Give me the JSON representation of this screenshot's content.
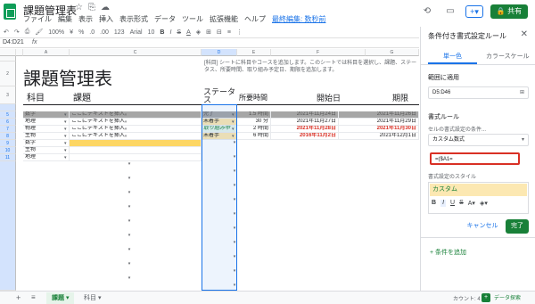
{
  "doc": {
    "title": "課題管理表"
  },
  "menu": [
    "ファイル",
    "編集",
    "表示",
    "挿入",
    "表示形式",
    "データ",
    "ツール",
    "拡張機能",
    "ヘルプ"
  ],
  "last_edit": "最終編集: 数秒前",
  "share_label": "共有",
  "toolbar": {
    "zoom": "100%",
    "currency": "¥",
    "percent": "%",
    "dec1": ".0",
    "dec2": ".00",
    "format": "123",
    "font": "Arial",
    "size": "10",
    "bold": "B",
    "italic": "I",
    "strike": "S",
    "color": "A"
  },
  "formula": {
    "namebox": "D4:D21",
    "fx": "fx"
  },
  "grid": {
    "columns": [
      "A",
      "B",
      "C",
      "D",
      "E",
      "F",
      "G"
    ],
    "title": "課題管理表",
    "description": "[科目] シートに科目やコースを追加します。このシートでは科目を選択し、課題、ステータス、所要時間、取り組み予定日、期限を追加します。",
    "headers": {
      "subject": "科目",
      "task": "課題",
      "status": "ステータス",
      "time": "所要時間",
      "start": "開始日",
      "due": "期限"
    },
    "rows": [
      {
        "subject": "数学",
        "task": "ここにテキストを挿入。",
        "status": "完了",
        "time": "1.5 時間",
        "start": "2021年11月24日",
        "due": "2021年11月26日"
      },
      {
        "subject": "地理",
        "task": "ここにテキストを挿入。",
        "status": "未着手",
        "time": "30 分",
        "start": "2021年11月27日",
        "due": "2021年11月29日"
      },
      {
        "subject": "物理",
        "task": "ここにテキストを挿入。",
        "status": "取り組み中",
        "time": "2 時間",
        "start": "2021年11月28日",
        "due": "2021年11月30日"
      },
      {
        "subject": "生物",
        "task": "ここにテキストを挿入。",
        "status": "未着手",
        "time": "6 時間",
        "start": "2016年11月2日",
        "due": "2021年12月1日"
      },
      {
        "subject": "数学",
        "task": "",
        "status": "",
        "time": "",
        "start": "",
        "due": ""
      },
      {
        "subject": "生物",
        "task": "",
        "status": "",
        "time": "",
        "start": "",
        "due": ""
      },
      {
        "subject": "地理",
        "task": "",
        "status": "",
        "time": "",
        "start": "",
        "due": ""
      }
    ]
  },
  "panel": {
    "title": "条件付き書式設定ルール",
    "tab_single": "単一色",
    "tab_scale": "カラースケール",
    "range_label": "範囲に適用",
    "range_value": "D5:D46",
    "rules_label": "書式ルール",
    "condition_label": "セルの書式設定の条件...",
    "condition_value": "カスタム数式",
    "formula_value": "=($A1=",
    "style_label": "書式設定のスタイル",
    "style_preview": "カスタム",
    "cancel": "キャンセル",
    "done": "完了",
    "add_rule": "条件を追加"
  },
  "sheets": {
    "active": "課題",
    "other": "科目"
  },
  "status": {
    "count": "カウント: 4",
    "explore": "データ探索"
  },
  "colors": {
    "green": "#188038",
    "blue": "#1a73e8",
    "red": "#d93025",
    "header_gray": "#a6a6a6",
    "yellow": "#fce8b2"
  }
}
